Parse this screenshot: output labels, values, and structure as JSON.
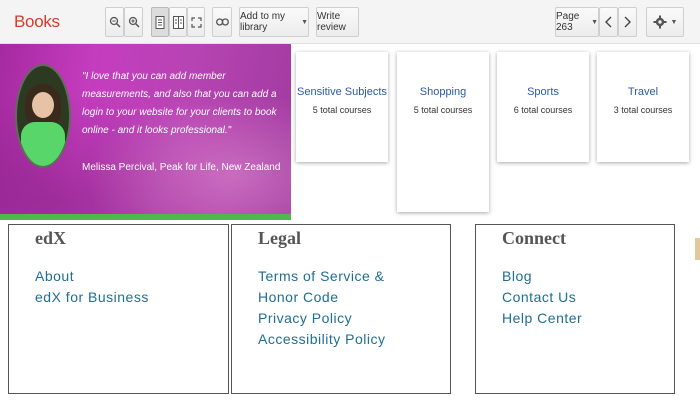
{
  "toolbar": {
    "brand": "Books",
    "add_to_library_label": "Add to my library",
    "write_review_label": "Write review",
    "page_indicator": "Page 263"
  },
  "testimonial": {
    "quote": "\"I love that you can add member measurements, and also that you can add a login to your website for your clients to book online - and it looks professional.\"",
    "attribution": "Melissa Percival, Peak for Life, New Zealand"
  },
  "courses": [
    {
      "title": "Sensitive Subjects",
      "count": "5 total courses"
    },
    {
      "title": "Shopping",
      "count": "5 total courses"
    },
    {
      "title": "Sports",
      "count": "6 total courses"
    },
    {
      "title": "Travel",
      "count": "3 total courses"
    }
  ],
  "footer": {
    "edx": {
      "heading": "edX",
      "links": [
        "About",
        "edX for Business"
      ]
    },
    "legal": {
      "heading": "Legal",
      "links": [
        "Terms of Service &",
        "Honor Code",
        "Privacy Policy",
        "Accessibility Policy"
      ]
    },
    "connect": {
      "heading": "Connect",
      "links": [
        "Blog",
        "Contact Us",
        "Help Center"
      ]
    }
  },
  "colors": {
    "brand": "#d93b2a",
    "hero_magenta": "#c53cbf",
    "hero_strip": "#4fb84a",
    "card_title": "#2c5aa0",
    "footer_link": "#1f6e93"
  },
  "icons": [
    "zoom-out-icon",
    "zoom-in-icon",
    "single-page-icon",
    "two-page-icon",
    "fullscreen-icon",
    "link-icon",
    "prev-page-icon",
    "next-page-icon",
    "settings-gear-icon"
  ]
}
